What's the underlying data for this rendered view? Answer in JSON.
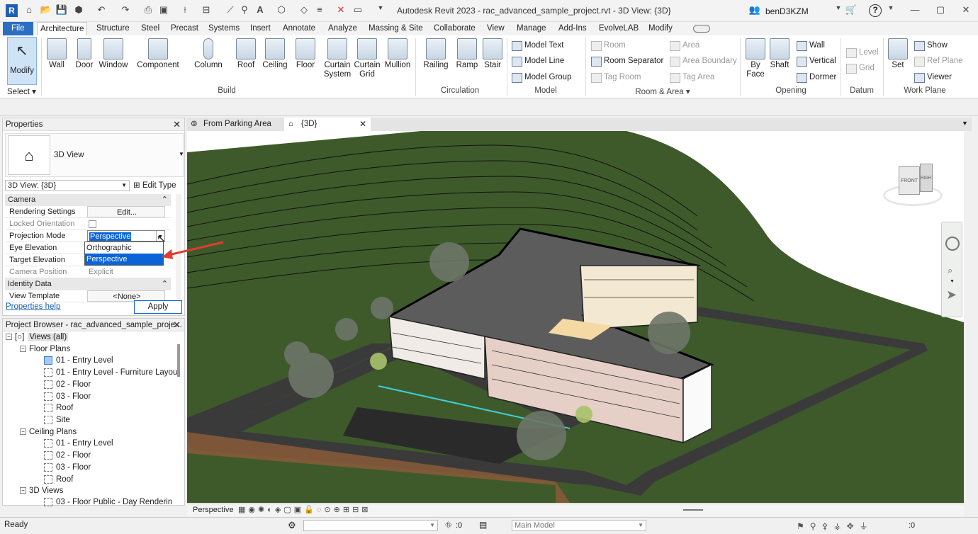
{
  "app": {
    "title": "Autodesk Revit 2023 - rac_advanced_sample_project.rvt - 3D View: {3D}",
    "logo": "R",
    "user": "benD3KZM",
    "help_label": "?"
  },
  "menu_tabs": [
    "File",
    "Architecture",
    "Structure",
    "Steel",
    "Precast",
    "Systems",
    "Insert",
    "Annotate",
    "Analyze",
    "Massing & Site",
    "Collaborate",
    "View",
    "Manage",
    "Add-Ins",
    "EvolveLAB",
    "Modify"
  ],
  "ribbon": {
    "select": {
      "modify": "Modify",
      "select": "Select"
    },
    "build": {
      "label": "Build",
      "items": [
        "Wall",
        "Door",
        "Window",
        "Component",
        "Column",
        "Roof",
        "Ceiling",
        "Floor",
        "Curtain System",
        "Curtain Grid",
        "Mullion"
      ]
    },
    "circulation": {
      "label": "Circulation",
      "items": [
        "Railing",
        "Ramp",
        "Stair"
      ]
    },
    "model": {
      "label": "Model",
      "items": [
        "Model Text",
        "Model Line",
        "Model Group"
      ]
    },
    "room_area": {
      "label": "Room & Area",
      "items": [
        "Room",
        "Room Separator",
        "Tag Room",
        "Area",
        "Area Boundary",
        "Tag Area"
      ]
    },
    "opening": {
      "label": "Opening",
      "items": [
        "By Face",
        "Shaft",
        "Wall",
        "Vertical",
        "Dormer"
      ]
    },
    "datum": {
      "label": "Datum",
      "items": [
        "Level",
        "Grid"
      ]
    },
    "work_plane": {
      "label": "Work Plane",
      "items": [
        "Set",
        "Show",
        "Ref Plane",
        "Viewer"
      ]
    }
  },
  "properties": {
    "title": "Properties",
    "type_name": "3D View",
    "selector": "3D View: {3D}",
    "edit_type": "Edit Type",
    "sections": {
      "camera": "Camera",
      "identity": "Identity Data"
    },
    "rows": {
      "rendering_settings": {
        "k": "Rendering Settings",
        "v": "Edit..."
      },
      "locked_orientation": {
        "k": "Locked Orientation",
        "v": ""
      },
      "projection_mode": {
        "k": "Projection Mode",
        "v": "Perspective"
      },
      "eye_elevation": {
        "k": "Eye Elevation",
        "v": ""
      },
      "target_elevation": {
        "k": "Target Elevation",
        "v": ""
      },
      "camera_position": {
        "k": "Camera Position",
        "v": "Explicit"
      },
      "view_template": {
        "k": "View Template",
        "v": "<None>"
      }
    },
    "dropdown_options": [
      "Orthographic",
      "Perspective"
    ],
    "help_link": "Properties help",
    "apply": "Apply"
  },
  "browser": {
    "title": "Project Browser - rac_advanced_sample_proje...",
    "root": "Views (all)",
    "floor_plans": "Floor Plans",
    "fp_items": [
      "01 - Entry Level",
      "01 - Entry Level - Furniture Layou",
      "02 - Floor",
      "03 - Floor",
      "Roof",
      "Site"
    ],
    "ceiling_plans": "Ceiling Plans",
    "cp_items": [
      "01 - Entry Level",
      "02 - Floor",
      "03 - Floor",
      "Roof"
    ],
    "views_3d": "3D Views",
    "v3_items": [
      "03 - Floor Public - Day Renderin"
    ]
  },
  "view_tabs": [
    "From Parking Area",
    "{3D}"
  ],
  "viewcube": {
    "front": "FRONT",
    "right": "RIGHT"
  },
  "view_bar": {
    "mode": "Perspective"
  },
  "status": {
    "ready": "Ready",
    "model": "Main Model",
    "count1": ":0",
    "count2": ":0"
  },
  "colors": {
    "file_tab": "#2b6fc2",
    "grass": "#3e5a2b",
    "road": "#3a3a3a",
    "roof": "#5c5c5c",
    "arrow": "#e03c31"
  }
}
